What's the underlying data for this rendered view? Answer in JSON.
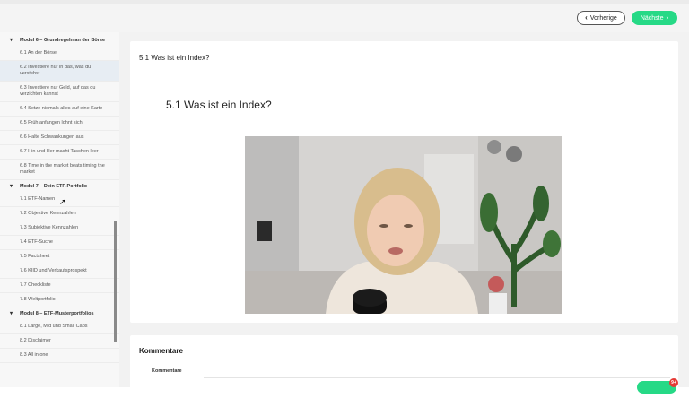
{
  "topbar": {
    "prev_label": "Vorherige",
    "next_label": "Nächste",
    "accent": "#26d986"
  },
  "sidebar": {
    "groups": [
      {
        "module": "Modul 6 – Grundregeln an der Börse",
        "items": [
          "6.1 An der Börse",
          "6.2 Investiere nur in das, was du verstehst",
          "6.3 Investiere nur Geld, auf das du verzichten kannst",
          "6.4 Setze niemals alles auf eine Karte",
          "6.5 Früh anfangen lohnt sich",
          "6.6 Halte Schwankungen aus",
          "6.7 Hin und Her macht Taschen leer",
          "6.8 Time in the market beats timing the market"
        ]
      },
      {
        "module": "Modul 7 – Dein ETF-Portfolio",
        "items": [
          "7.1 ETF-Namen",
          "7.2 Objektive Kennzahlen",
          "7.3 Subjektive Kennzahlen",
          "7.4 ETF-Suche",
          "7.5 Factsheet",
          "7.6 KIID und Verkaufsprospekt",
          "7.7 Checkliste",
          "7.8 Weltportfolio"
        ]
      },
      {
        "module": "Modul 8 – ETF-Musterportfolios",
        "items": [
          "8.1 Large, Mid und Small Caps",
          "8.2 Disclaimer",
          "8.3 All in one"
        ]
      }
    ]
  },
  "lesson": {
    "header": "5.1 Was ist ein Index?",
    "title": "5.1 Was ist ein Index?"
  },
  "comments": {
    "title": "Kommentare",
    "label": "Kommentare"
  },
  "chat": {
    "badge": "9+"
  }
}
